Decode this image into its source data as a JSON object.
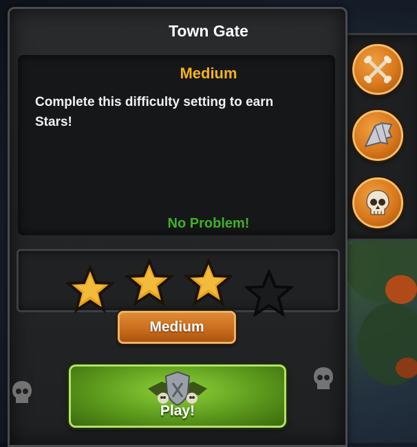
{
  "window": {
    "title": "Town Gate"
  },
  "info": {
    "difficulty": "Medium",
    "description": "Complete this difficulty setting to earn Stars!",
    "rating": "No Problem!"
  },
  "stars": {
    "earned": 3,
    "total": 4
  },
  "difficulty_button": {
    "label": "Medium"
  },
  "play_button": {
    "label": "Play!"
  },
  "side_buttons": [
    {
      "icon": "crossbones-icon"
    },
    {
      "icon": "bat-wing-icon"
    },
    {
      "icon": "skull-icon"
    }
  ],
  "colors": {
    "title": "#ffffff",
    "difficulty": "#f5b31a",
    "rating": "#3fb02a",
    "accent_orange": "#d9781c",
    "play_green": "#5c9a1c"
  }
}
